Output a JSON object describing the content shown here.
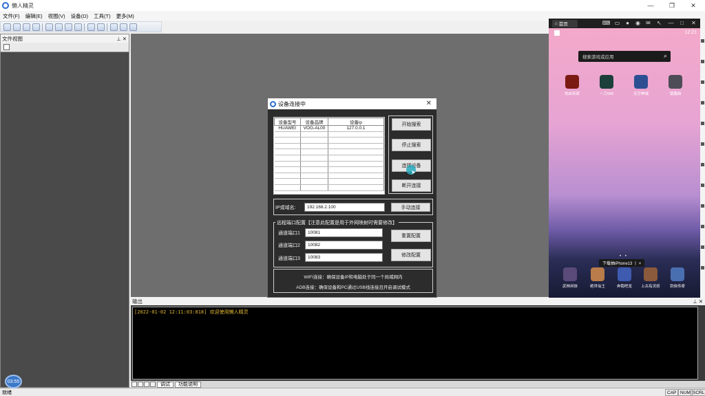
{
  "window": {
    "title": "懒人精灵",
    "min": "—",
    "max": "❐",
    "close": "✕"
  },
  "menu": [
    "文件(F)",
    "编辑(E)",
    "视图(V)",
    "设备(D)",
    "工具(T)",
    "更多(M)"
  ],
  "left_panel": {
    "title": "文件视图",
    "controls": "⊥ ✕"
  },
  "output_panel": {
    "title": "输出",
    "controls": "⊥ ✕",
    "log": "[2022-01-02 12:11:03:818] 欢迎使用懒人精灵",
    "tabs": [
      "调试",
      "功能说明"
    ]
  },
  "status": {
    "ready": "就绪",
    "indicators": [
      "CAP",
      "NUM",
      "SCRL"
    ]
  },
  "timer": "03:55",
  "dialog": {
    "title": "设备连接中",
    "close": "✕",
    "table": {
      "headers": [
        "设备型号",
        "设备品牌",
        "设备ip"
      ],
      "rows": [
        [
          "HUAWEI",
          "VOG-AL00",
          "127.0.0.1"
        ]
      ]
    },
    "buttons": {
      "start_search": "开始搜索",
      "stop_search": "停止搜索",
      "connect": "连接设备",
      "disconnect": "断开连接"
    },
    "ip": {
      "label": "IP或域名:",
      "value": "192.168.2.100",
      "manual": "手动连接"
    },
    "ports": {
      "legend": "远程端口配置【注意此配置是用于外网映射时需要修改】",
      "channels": [
        {
          "label": "通道端口1",
          "value": "10081"
        },
        {
          "label": "通道端口2",
          "value": "10082"
        },
        {
          "label": "通道端口3",
          "value": "10083"
        }
      ],
      "reset": "重置配置",
      "modify": "修改配置"
    },
    "notes": [
      "WIFI连接：确保设备IP和电脑处于同一个局域网内",
      "ADB连接：确保设备和PC通过USB线连接且开启调试模式"
    ]
  },
  "phone": {
    "tab": "首页",
    "time": "12:21",
    "search_placeholder": "搜索游戏或应用",
    "apps_top": [
      {
        "name": "热血传奇",
        "color": "#7a1a12"
      },
      {
        "name": "一刀999",
        "color": "#1b3f3a"
      },
      {
        "name": "无尽神域",
        "color": "#2c4f93"
      },
      {
        "name": "镇魔曲",
        "color": "#4d4d57"
      }
    ],
    "apps_bottom": [
      {
        "name": "武林闲侠",
        "color": "#5a4a7a"
      },
      {
        "name": "绝世仙王",
        "color": "#b97c4a"
      },
      {
        "name": "奔跑吧龙",
        "color": "#3f5bb0"
      },
      {
        "name": "上古有灵妖",
        "color": "#8b5a3c"
      },
      {
        "name": "剑侠传奇",
        "color": "#4a6fb0"
      }
    ],
    "tip": "下载抽iPhone13 丨 ×"
  }
}
